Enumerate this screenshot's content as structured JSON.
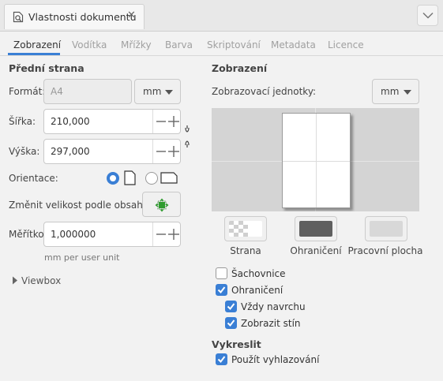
{
  "dock": {
    "tab_title": "Vlastnosti dokumentu",
    "close_glyph": "✕"
  },
  "tabs": [
    {
      "label": "Zobrazení",
      "active": true
    },
    {
      "label": "Vodítka",
      "active": false
    },
    {
      "label": "Mřížky",
      "active": false
    },
    {
      "label": "Barva",
      "active": false
    },
    {
      "label": "Skriptování",
      "active": false
    },
    {
      "label": "Metadata",
      "active": false
    },
    {
      "label": "Licence",
      "active": false
    }
  ],
  "front_page": {
    "heading": "Přední strana",
    "format_label": "Formát:",
    "format_value": "A4",
    "format_unit": "mm",
    "width_label": "Šířka:",
    "width_value": "210,000",
    "height_label": "Výška:",
    "height_value": "297,000",
    "orientation_label": "Orientace:",
    "orientation_selected": "portrait",
    "resize_label": "Změnit velikost podle obsahu:",
    "scale_label": "Měřítko:",
    "scale_value": "1,000000",
    "scale_hint": "mm per user unit",
    "viewbox_label": "Viewbox"
  },
  "display": {
    "heading": "Zobrazení",
    "units_label": "Zobrazovací jednotky:",
    "units_value": "mm",
    "swatches": [
      {
        "caption": "Strana",
        "kind": "checker"
      },
      {
        "caption": "Ohraničení",
        "color": "#5f5f5f"
      },
      {
        "caption": "Pracovní plocha",
        "color": "#d8d8d8"
      }
    ],
    "checkboxes": [
      {
        "label": "Šachovnice",
        "checked": false
      },
      {
        "label": "Ohraničení",
        "checked": true
      },
      {
        "label": "Vždy navrchu",
        "checked": true
      },
      {
        "label": "Zobrazit stín",
        "checked": true
      }
    ]
  },
  "render": {
    "heading": "Vykreslit",
    "antialias_label": "Použít vyhlazování",
    "antialias_checked": true
  },
  "colors": {
    "accent": "#3a7fd5",
    "preview_bg": "#d4d4d4",
    "page": "#ffffff"
  }
}
